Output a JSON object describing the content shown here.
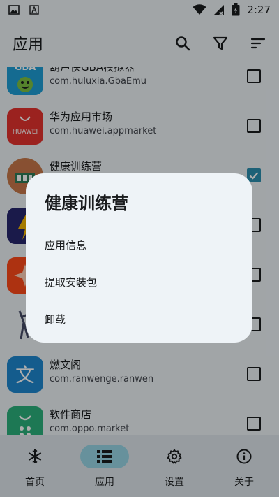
{
  "status_bar": {
    "time": "2:27"
  },
  "app_bar": {
    "title": "应用"
  },
  "apps": [
    {
      "name": "葫芦侠GBA模拟器",
      "package": "com.huluxia.GbaEmu",
      "checked": false,
      "icon": "gba-emulator-icon"
    },
    {
      "name": "华为应用市场",
      "package": "com.huawei.appmarket",
      "checked": false,
      "icon": "huawei-appmarket-icon",
      "icon_text": "HUAWEI"
    },
    {
      "name": "健康训练营",
      "package": "",
      "checked": true,
      "icon": "health-camp-icon"
    },
    {
      "name": "",
      "package": "",
      "checked": false,
      "icon": "app-icon-4"
    },
    {
      "name": "",
      "package": "",
      "checked": false,
      "icon": "app-icon-5"
    },
    {
      "name": "",
      "package": "",
      "checked": false,
      "icon": "app-icon-6"
    },
    {
      "name": "燃文阁",
      "package": "com.ranwenge.ranwen",
      "checked": false,
      "icon": "ranwenge-icon",
      "icon_text": "文"
    },
    {
      "name": "软件商店",
      "package": "com.oppo.market",
      "checked": false,
      "icon": "software-store-icon"
    }
  ],
  "dialog": {
    "title": "健康训练营",
    "items": [
      "应用信息",
      "提取安装包",
      "卸载"
    ]
  },
  "bottom_nav": [
    {
      "label": "首页",
      "icon": "snowflake-icon",
      "active": false
    },
    {
      "label": "应用",
      "icon": "list-icon",
      "active": true
    },
    {
      "label": "设置",
      "icon": "gear-icon",
      "active": false
    },
    {
      "label": "关于",
      "icon": "info-icon",
      "active": false
    }
  ],
  "colors": {
    "accent": "#2c8fb0",
    "nav_active": "#98d6e6",
    "background": "#eef3f7"
  }
}
